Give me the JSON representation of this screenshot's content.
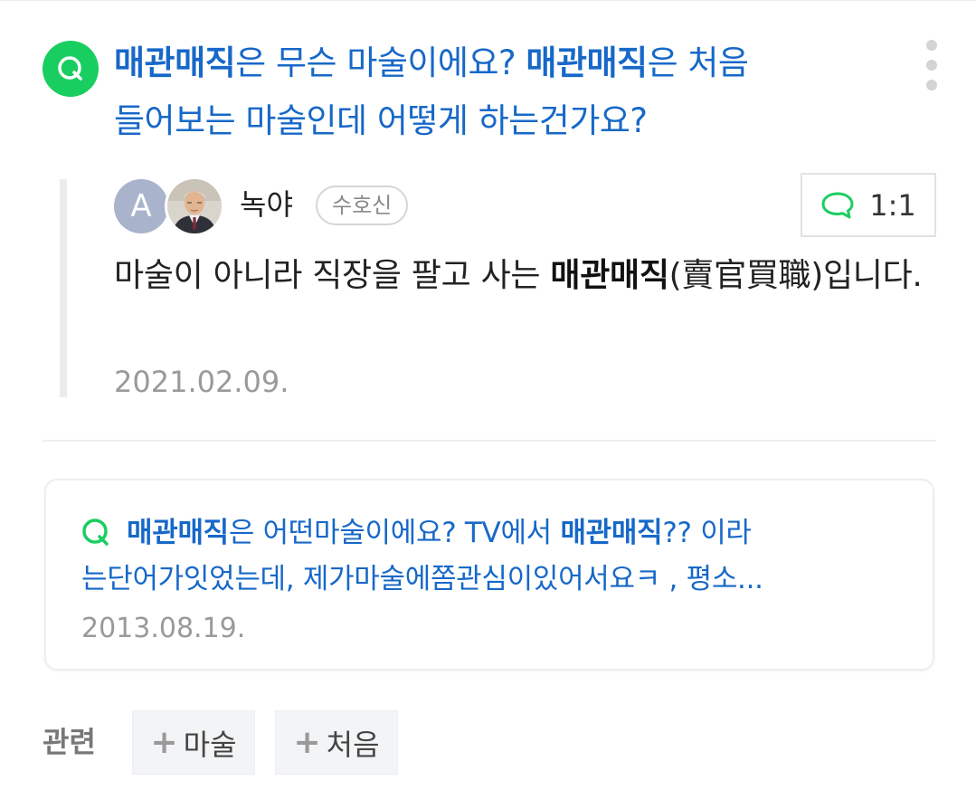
{
  "question": {
    "badge": "Q",
    "keyword": "매관매직",
    "part1": "은 무슨 마술이에요? ",
    "part2": "은 처음",
    "line2": "들어보는 마술인데 어떻게 하는건가요?"
  },
  "answer": {
    "avatar_letter": "A",
    "author_name": "녹야",
    "rank": "수호신",
    "chat_label": "1:1",
    "text_part1": "마술이 아니라 직장을 팔고 사는 ",
    "text_bold": "매관매직",
    "text_part2": "(賣官買職)입니다.",
    "date": "2021.02.09."
  },
  "related": {
    "keyword": "매관매직",
    "part1": "은 어떤마술이에요? TV에서 ",
    "part2": "?? 이라",
    "line2": "는단어가잇었는데, 제가마술에쫌관심이있어서요ㅋ , 평소...",
    "date": "2013.08.19."
  },
  "tags": {
    "label": "관련",
    "plus": "+",
    "items": [
      "마술",
      "처음"
    ]
  },
  "colors": {
    "accent_green": "#19ce60",
    "link_blue": "#1768c8",
    "date_gray": "#9a9a9a"
  },
  "icons": {
    "question": "q-circle-icon",
    "more": "more-vertical-icon",
    "chat": "speech-bubble-icon",
    "related_question": "q-outline-icon",
    "tag_plus": "plus-icon"
  }
}
